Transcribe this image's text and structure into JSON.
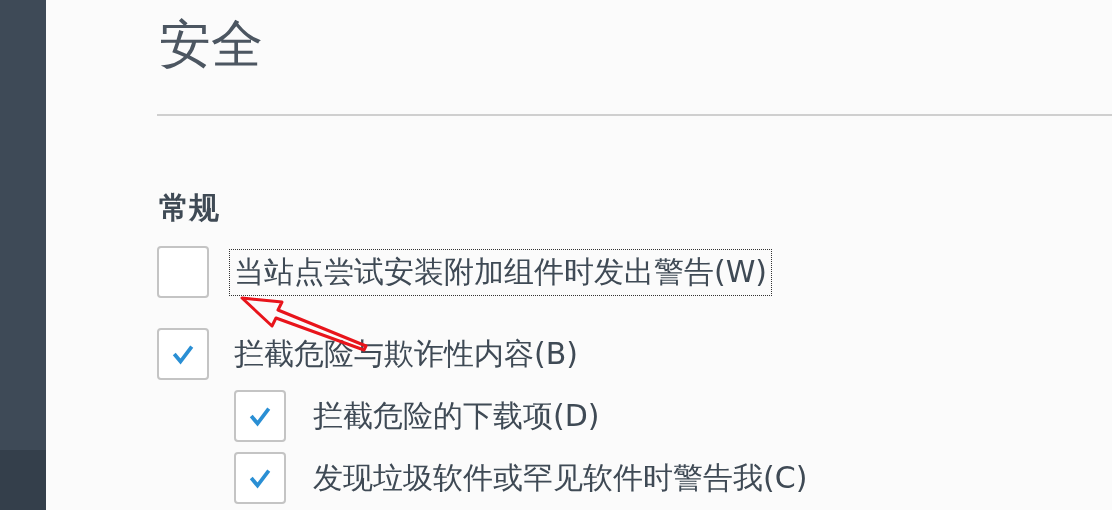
{
  "title": "安全",
  "section": {
    "heading": "常规",
    "options": [
      {
        "label": "当站点尝试安装附加组件时发出警告(W)",
        "checked": false,
        "focused": true
      },
      {
        "label": "拦截危险与欺诈性内容(B)",
        "checked": true,
        "focused": false,
        "children": [
          {
            "label": "拦截危险的下载项(D)",
            "checked": true,
            "focused": false
          },
          {
            "label": "发现垃圾软件或罕见软件时警告我(C)",
            "checked": true,
            "focused": false
          }
        ]
      }
    ]
  }
}
